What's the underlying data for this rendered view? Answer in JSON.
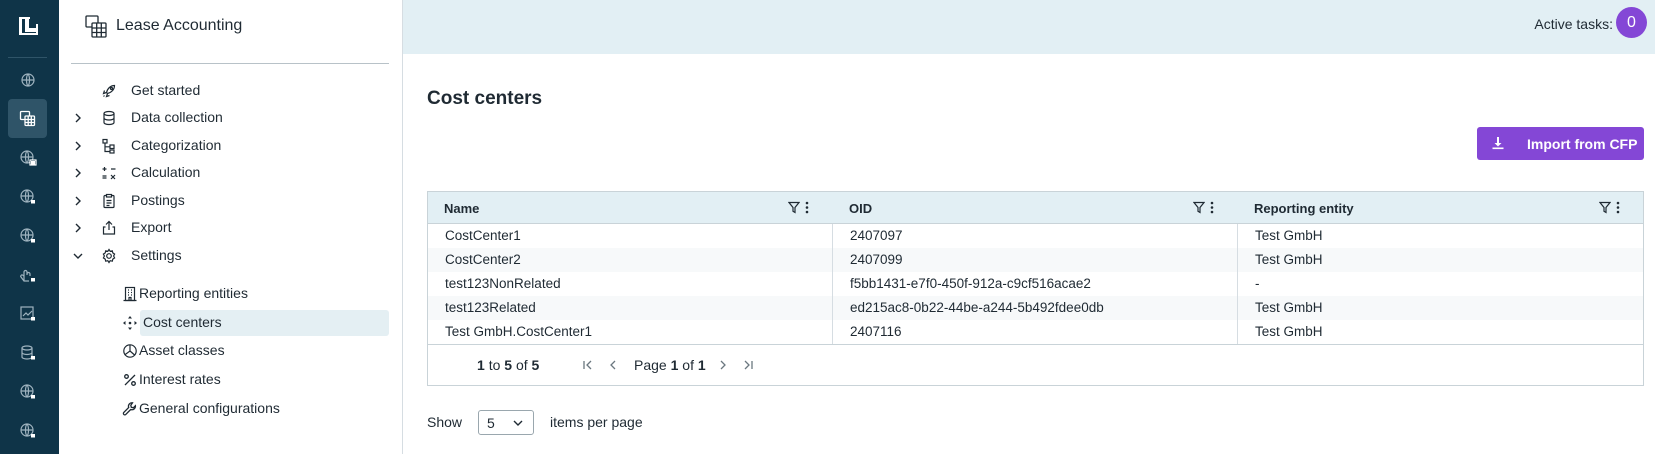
{
  "rail": {
    "items": [
      {
        "icon": "globe-icon"
      },
      {
        "icon": "lease-accounting-icon",
        "active": true
      },
      {
        "icon": "globe-lock-icon"
      },
      {
        "icon": "globe-lock-icon"
      },
      {
        "icon": "globe-lock-icon"
      },
      {
        "icon": "hand-lock-icon"
      },
      {
        "icon": "chart-lock-icon"
      },
      {
        "icon": "db-lock-icon"
      },
      {
        "icon": "globe-lock-icon"
      },
      {
        "icon": "globe-lock-icon"
      }
    ]
  },
  "sidebar": {
    "app_title": "Lease Accounting",
    "nav": [
      {
        "label": "Get started",
        "icon": "rocket-icon",
        "expandable": false
      },
      {
        "label": "Data collection",
        "icon": "database-icon",
        "expandable": true
      },
      {
        "label": "Categorization",
        "icon": "hierarchy-icon",
        "expandable": true
      },
      {
        "label": "Calculation",
        "icon": "calculator-icon",
        "expandable": true
      },
      {
        "label": "Postings",
        "icon": "clipboard-icon",
        "expandable": true
      },
      {
        "label": "Export",
        "icon": "export-icon",
        "expandable": true
      },
      {
        "label": "Settings",
        "icon": "gear-icon",
        "expandable": true,
        "expanded": true
      }
    ],
    "sub_nav": [
      {
        "label": "Reporting entities",
        "icon": "building-icon"
      },
      {
        "label": "Cost centers",
        "icon": "move-icon",
        "active": true
      },
      {
        "label": "Asset classes",
        "icon": "pie-icon"
      },
      {
        "label": "Interest rates",
        "icon": "percent-icon"
      },
      {
        "label": "General configurations",
        "icon": "wrench-icon"
      }
    ]
  },
  "header": {
    "active_tasks_label": "Active tasks:",
    "active_tasks_count": "0"
  },
  "main": {
    "title": "Cost centers",
    "import_button": "Import from CFP",
    "table": {
      "columns": [
        "Name",
        "OID",
        "Reporting entity"
      ],
      "rows": [
        [
          "CostCenter1",
          "2407097",
          "Test GmbH"
        ],
        [
          "CostCenter2",
          "2407099",
          "Test GmbH"
        ],
        [
          "test123NonRelated",
          "f5bb1431-e7f0-450f-912a-c9cf516acae2",
          "-"
        ],
        [
          "test123Related",
          "ed215ac8-0b22-44be-a244-5b492fdee0db",
          "Test GmbH"
        ],
        [
          "Test GmbH.CostCenter1",
          "2407116",
          "Test GmbH"
        ]
      ]
    },
    "pager": {
      "from": "1",
      "to_word": "to",
      "to": "5",
      "of_word": "of",
      "total": "5",
      "page_word": "Page",
      "page": "1",
      "page_of_word": "of",
      "pages": "1"
    },
    "page_size": {
      "show_label": "Show",
      "value": "5",
      "suffix": "items per page"
    }
  },
  "colors": {
    "rail_bg": "#0f3448",
    "accent": "#8447d6",
    "header_bg": "#e2eff4",
    "active_nav_bg": "#e4eff3"
  }
}
